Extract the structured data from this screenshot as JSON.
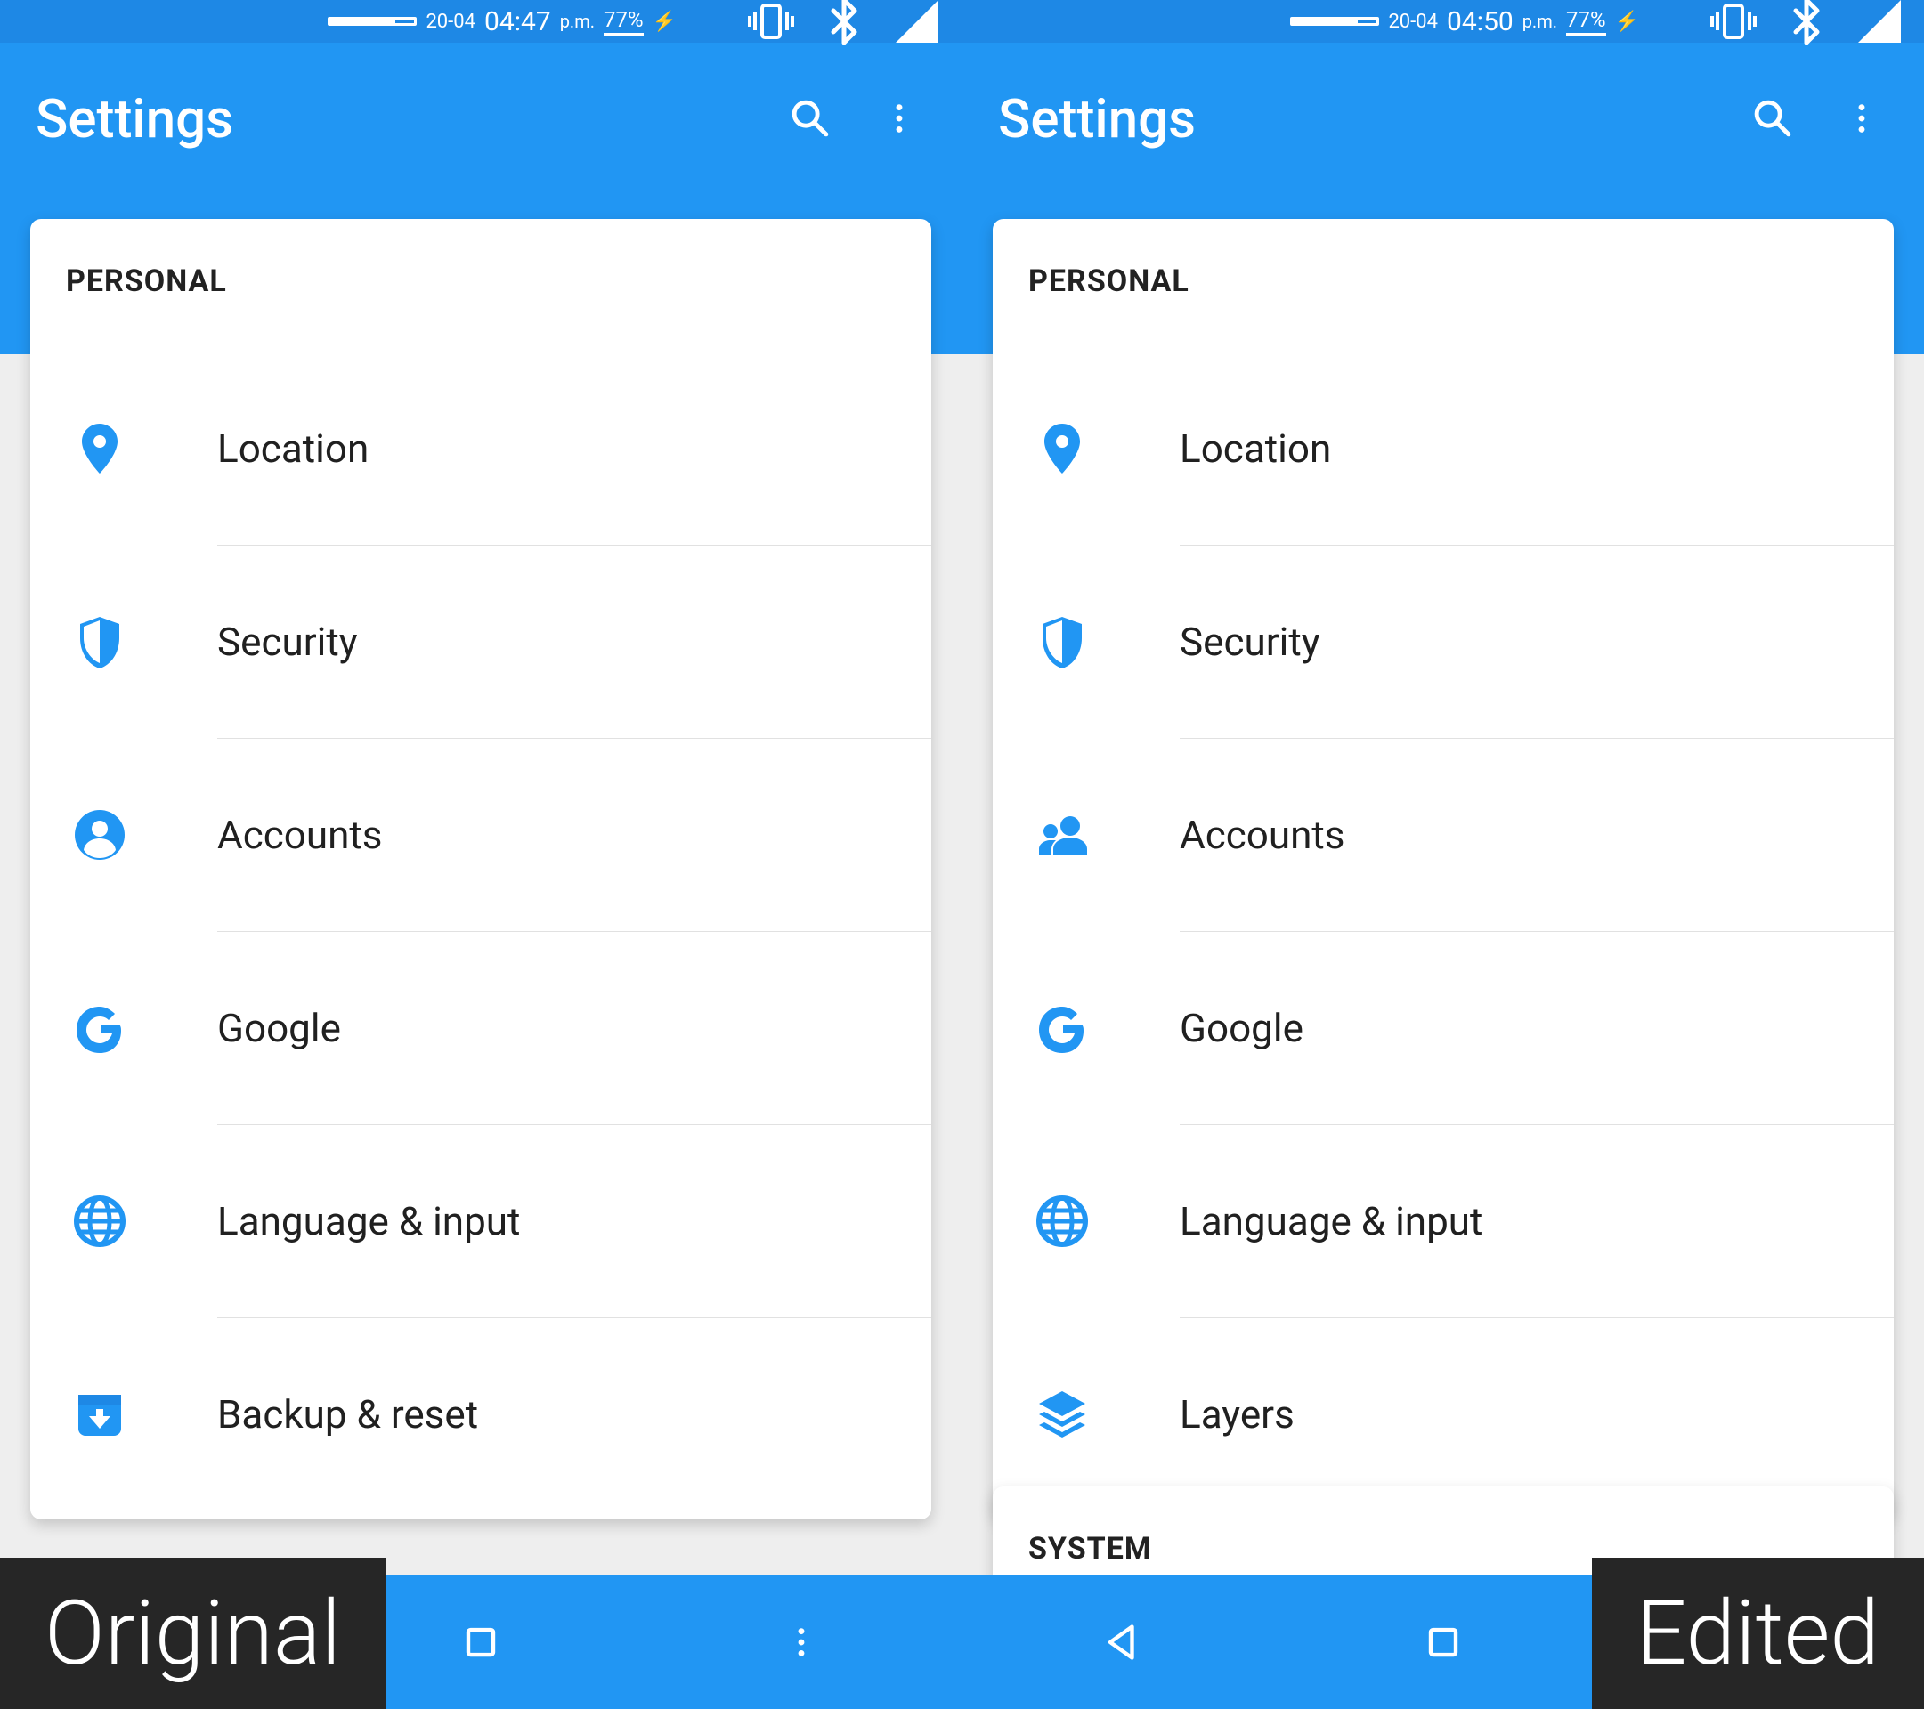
{
  "left": {
    "statusbar": {
      "date": "20-04",
      "time": "04:47",
      "ampm": "p.m.",
      "battery_pct": "77%"
    },
    "appbar": {
      "title": "Settings"
    },
    "section_header": "PERSONAL",
    "items": [
      {
        "icon": "location-pin-icon",
        "label": "Location"
      },
      {
        "icon": "shield-icon",
        "label": "Security"
      },
      {
        "icon": "person-circle-icon",
        "label": "Accounts"
      },
      {
        "icon": "google-g-icon",
        "label": "Google"
      },
      {
        "icon": "globe-icon",
        "label": "Language & input"
      },
      {
        "icon": "archive-down-icon",
        "label": "Backup & reset"
      }
    ],
    "caption": "Original"
  },
  "right": {
    "statusbar": {
      "date": "20-04",
      "time": "04:50",
      "ampm": "p.m.",
      "battery_pct": "77%"
    },
    "appbar": {
      "title": "Settings"
    },
    "section_header": "PERSONAL",
    "items": [
      {
        "icon": "location-pin-icon",
        "label": "Location"
      },
      {
        "icon": "shield-icon",
        "label": "Security"
      },
      {
        "icon": "people-icon",
        "label": "Accounts"
      },
      {
        "icon": "google-g-icon",
        "label": "Google"
      },
      {
        "icon": "globe-icon",
        "label": "Language & input"
      },
      {
        "icon": "layers-icon",
        "label": "Layers"
      }
    ],
    "next_section_header": "SYSTEM",
    "caption": "Edited"
  },
  "colors": {
    "primary": "#2196f3",
    "statusbar": "#1e88e5",
    "icon": "#2196f3"
  }
}
